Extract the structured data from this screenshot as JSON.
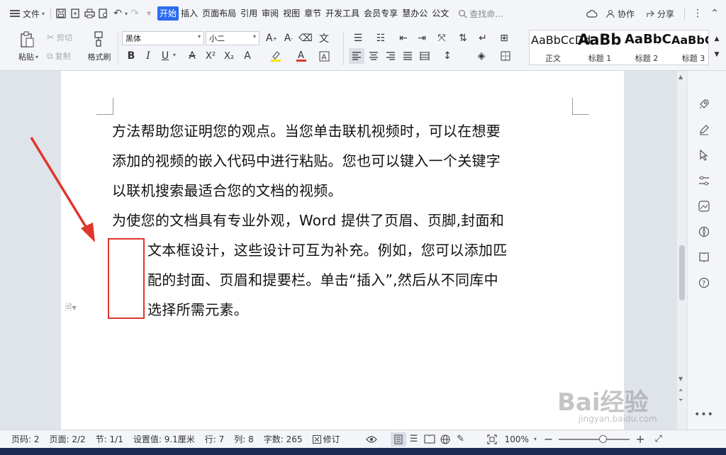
{
  "menubar": {
    "file_label": "文件",
    "tabs": [
      "开始",
      "插入",
      "页面布局",
      "引用",
      "审阅",
      "视图",
      "章节",
      "开发工具",
      "会员专享",
      "慧办公",
      "公文"
    ],
    "search_placeholder": "查找命...",
    "collab_label": "协作",
    "share_label": "分享"
  },
  "ribbon": {
    "paste_label": "粘贴",
    "cut_label": "剪切",
    "copy_label": "复制",
    "format_painter_label": "格式刷",
    "font_name": "黑体",
    "font_size": "小二",
    "styles": [
      {
        "sample": "AaBbCcDd",
        "name": "正文"
      },
      {
        "sample": "AaBb",
        "name": "标题 1"
      },
      {
        "sample": "AaBbC",
        "name": "标题 2"
      },
      {
        "sample": "AaBbC",
        "name": "标题 3"
      }
    ]
  },
  "document": {
    "lines": [
      "方法帮助您证明您的观点。当您单击联机视频时，可以在想要",
      "添加的视频的嵌入代码中进行粘贴。您也可以键入一个关键字",
      "以联机搜索最适合您的文档的视频。",
      "为使您的文档具有专业外观，Word 提供了页眉、页脚,封面和",
      "文本框设计，这些设计可互为补充。例如，您可以添加匹",
      "配的封面、页眉和提要栏。单击“插入”,然后从不同库中",
      "选择所需元素。"
    ]
  },
  "statusbar": {
    "page_num": "页码: 2",
    "pages": "页面: 2/2",
    "section": "节: 1/1",
    "setting": "设置值: 9.1厘米",
    "row": "行: 7",
    "col": "列: 8",
    "word_count": "字数: 265",
    "revise_label": "修订",
    "zoom": "100%",
    "zoom_fraction": 0.62
  },
  "watermark": {
    "brand": "Bai经验",
    "url": "jingyan.baidu.com"
  },
  "colors": {
    "accent": "#2b6cf0",
    "annotation_red": "#e0362b"
  }
}
